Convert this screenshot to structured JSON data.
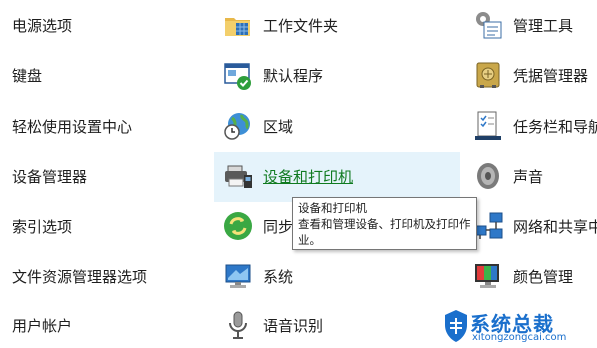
{
  "items": {
    "power": "电源选项",
    "work_folders": "工作文件夹",
    "admin_tools": "管理工具",
    "keyboard": "键盘",
    "default_programs": "默认程序",
    "credential_manager": "凭据管理器",
    "ease_of_access": "轻松使用设置中心",
    "region": "区域",
    "taskbar": "任务栏和导航",
    "device_manager": "设备管理器",
    "devices_printers": "设备和打印机",
    "sound": "声音",
    "indexing": "索引选项",
    "sync_center": "同步",
    "network_center": "网络和共享中",
    "file_explorer_options": "文件资源管理器选项",
    "system": "系统",
    "color_management": "颜色管理",
    "user_accounts": "用户帐户",
    "speech_recognition": "语音识别"
  },
  "tooltip": {
    "title": "设备和打印机",
    "description": "查看和管理设备、打印机及打印作业。"
  },
  "watermark": {
    "text": "系统总裁",
    "url": "xitongzongcai.com"
  },
  "colors": {
    "hover_background": "#e5f3fb",
    "hover_link": "#0f7a1f",
    "accent_blue": "#1a6fcc"
  }
}
